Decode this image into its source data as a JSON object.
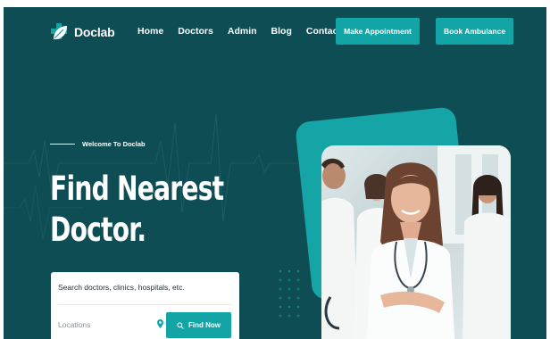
{
  "header": {
    "logo_text": "Doclab",
    "nav": [
      "Home",
      "Doctors",
      "Admin",
      "Blog",
      "Contact"
    ],
    "make_appointment": "Make Appointment",
    "book_ambulance": "Book Ambulance"
  },
  "hero": {
    "eyebrow": "Welcome To Doclab",
    "title_line1": "Find Nearest",
    "title_line2": "Doctor."
  },
  "search": {
    "query_placeholder": "Search doctors, clinics, hospitals, etc.",
    "location_placeholder": "Locations",
    "find_button": "Find Now"
  },
  "colors": {
    "background": "#0d4d53",
    "accent": "#13a4a5",
    "text": "#ffffff"
  },
  "icons": {
    "logo": "medical-cross-leaf-icon",
    "location": "map-pin-icon",
    "search": "search-icon"
  }
}
